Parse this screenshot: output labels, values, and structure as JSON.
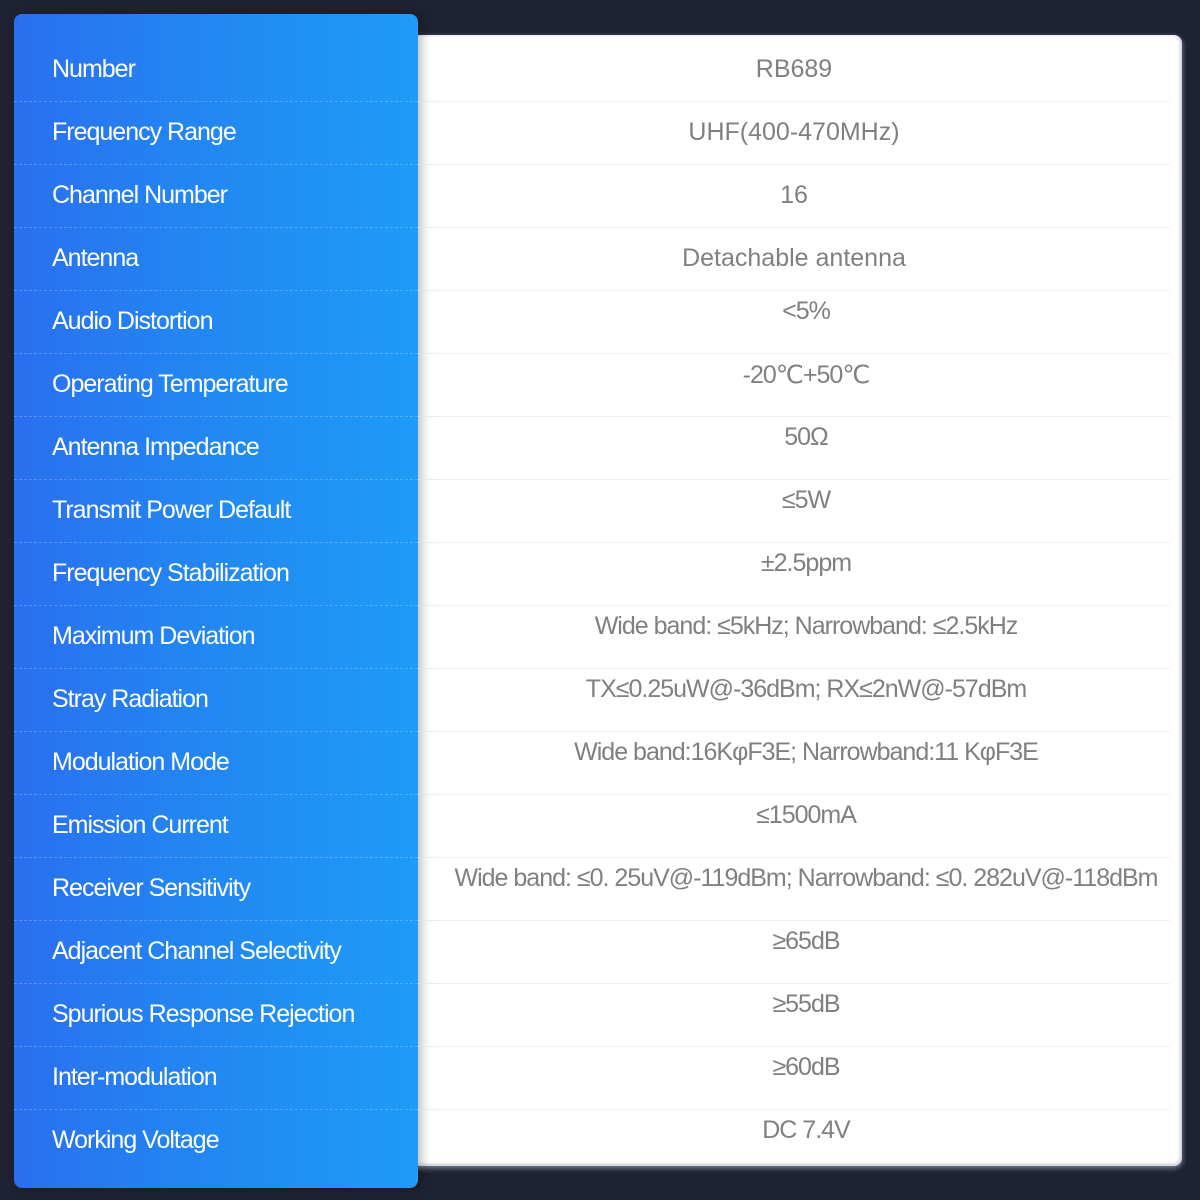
{
  "colors": {
    "background": "#1e2232",
    "label_panel_start": "#2a6ff0",
    "label_panel_end": "#1e9cf6",
    "label_text": "#ffffff",
    "value_text": "#808080",
    "value_panel": "#ffffff"
  },
  "specs": [
    {
      "label": "Number",
      "value": "RB689"
    },
    {
      "label": "Frequency Range",
      "value": "UHF(400-470MHz)"
    },
    {
      "label": "Channel Number",
      "value": "16"
    },
    {
      "label": "Antenna",
      "value": "Detachable antenna"
    },
    {
      "label": "Audio Distortion",
      "value": "<5%"
    },
    {
      "label": "Operating Temperature",
      "value": "-20℃+50℃"
    },
    {
      "label": "Antenna Impedance",
      "value": "50Ω"
    },
    {
      "label": "Transmit Power Default",
      "value": "≤5W"
    },
    {
      "label": "Frequency Stabilization",
      "value": "±2.5ppm"
    },
    {
      "label": "Maximum Deviation",
      "value": "Wide band: ≤5kHz; Narrowband: ≤2.5kHz"
    },
    {
      "label": "Stray Radiation",
      "value": "TX≤0.25uW@-36dBm; RX≤2nW@-57dBm"
    },
    {
      "label": "Modulation Mode",
      "value": "Wide band:16KφF3E; Narrowband:11 KφF3E"
    },
    {
      "label": "Emission Current",
      "value": "≤1500mA"
    },
    {
      "label": "Receiver Sensitivity",
      "value": "Wide band: ≤0. 25uV@-119dBm; Narrowband: ≤0. 282uV@-118dBm"
    },
    {
      "label": "Adjacent Channel Selectivity",
      "value": "≥65dB"
    },
    {
      "label": "Spurious Response Rejection",
      "value": "≥55dB"
    },
    {
      "label": "Inter-modulation",
      "value": "≥60dB"
    },
    {
      "label": "Working Voltage",
      "value": "DC 7.4V"
    }
  ]
}
